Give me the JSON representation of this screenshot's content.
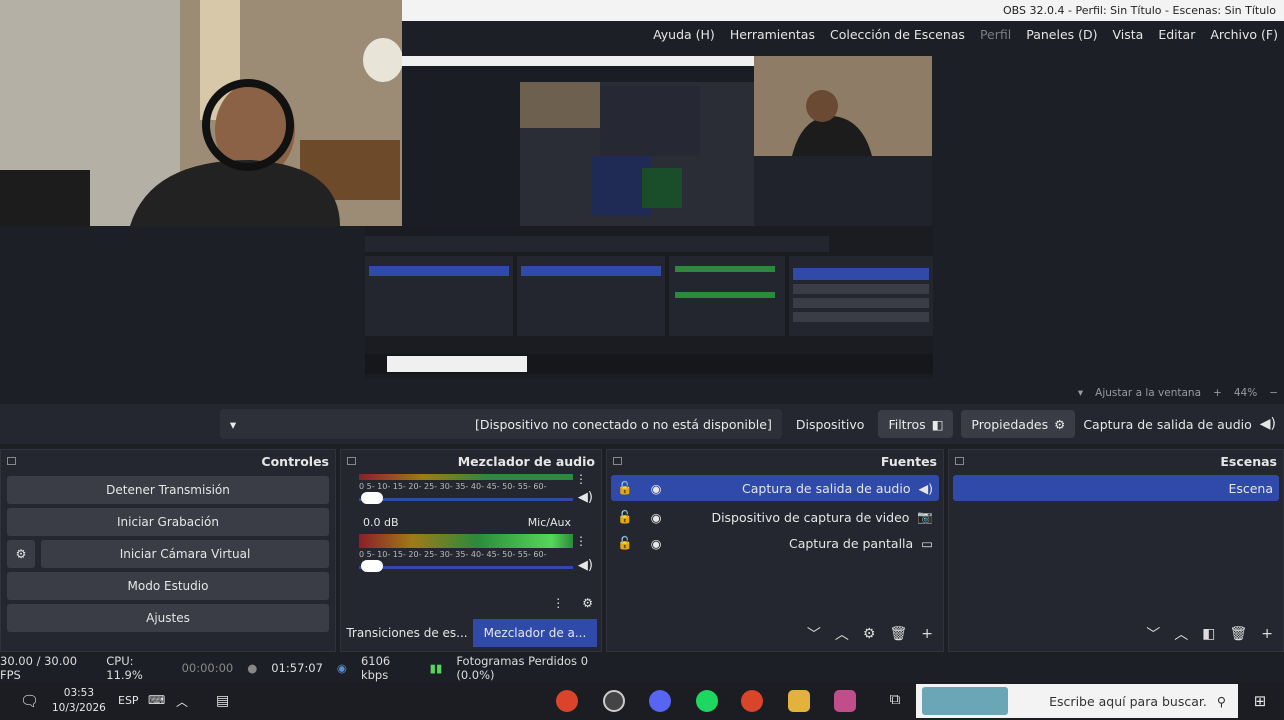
{
  "window": {
    "title": "OBS 32.0.4 - Perfil: Sin Título - Escenas: Sin Título"
  },
  "menu": [
    "Archivo (F)",
    "Editar",
    "Vista",
    "Paneles (D)",
    "Perfil",
    "Colección de Escenas",
    "Herramientas",
    "Ayuda (H)"
  ],
  "zoom": {
    "value": "44%",
    "fit": "Ajustar a la ventana"
  },
  "sourcebar": {
    "source": "Captura de salida de audio",
    "props": "Propiedades",
    "filters": "Filtros",
    "device_label": "Dispositivo",
    "device_value": "[Dispositivo no conectado o no está disponible]"
  },
  "scenes": {
    "title": "Escenas",
    "items": [
      "Escena"
    ]
  },
  "sources": {
    "title": "Fuentes",
    "items": [
      "Captura de salida de audio",
      "Dispositivo de captura de video",
      "Captura de pantalla"
    ]
  },
  "mixer": {
    "title": "Mezclador de audio",
    "ch2_name": "Mic/Aux",
    "ch2_db": "0.0 dB",
    "ticks": "-60 -55 -50 -45 -40 -35 -30 -25 -20 -15 -10 -5 0",
    "tab1": "Mezclador de a...",
    "tab2": "Transiciones de es..."
  },
  "controls": {
    "title": "Controles",
    "items": [
      "Detener Transmisión",
      "Iniciar Grabación",
      "Iniciar Cámara Virtual",
      "Modo Estudio",
      "Ajustes"
    ]
  },
  "status": {
    "dropped": "Fotogramas Perdidos 0 (0.0%)",
    "kbps": "6106 kbps",
    "stream_time": "01:57:07",
    "rec_time": "00:00:00",
    "cpu": "CPU: 11.9%",
    "fps": "30.00 / 30.00 FPS"
  },
  "taskbar": {
    "search": "Escribe aquí para buscar.",
    "lang": "ESP",
    "time": "03:53",
    "date": "10/3/2026"
  },
  "colors": {
    "accent": "#2f4aa8",
    "bg": "#1d1f26",
    "panel": "#24272f"
  }
}
